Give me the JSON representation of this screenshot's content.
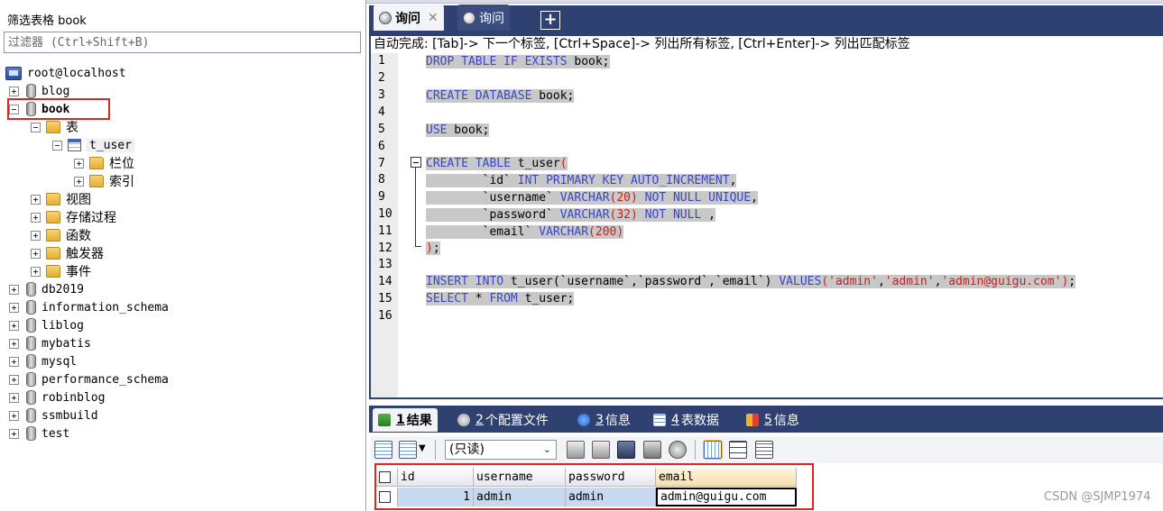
{
  "object_browser": {
    "filter_title": "筛选表格 book",
    "filter_placeholder": "过滤器 (Ctrl+Shift+B)",
    "connection": "root@localhost",
    "databases_before": [
      "blog"
    ],
    "selected_db": "book",
    "book_children": {
      "tables_folder": "表",
      "table_name": "t_user",
      "table_children": [
        "栏位",
        "索引"
      ],
      "other_folders": [
        "视图",
        "存储过程",
        "函数",
        "触发器",
        "事件"
      ]
    },
    "databases_after": [
      "db2019",
      "information_schema",
      "liblog",
      "mybatis",
      "mysql",
      "performance_schema",
      "robinblog",
      "ssmbuild",
      "test"
    ]
  },
  "query_tabs": [
    {
      "label": "询问",
      "active": true,
      "close": "✕"
    },
    {
      "label": "询问",
      "active": false
    }
  ],
  "add_tab_label": "+",
  "autocomplete_hint": "自动完成: [Tab]-> 下一个标签, [Ctrl+Space]-> 列出所有标签, [Ctrl+Enter]-> 列出匹配标签",
  "code_lines": [
    "1",
    "2",
    "3",
    "4",
    "5",
    "6",
    "7",
    "8",
    "9",
    "10",
    "11",
    "12",
    "13",
    "14",
    "15",
    "16"
  ],
  "code": {
    "l1": {
      "kw": "DROP TABLE IF EXISTS",
      "rest": " book;"
    },
    "l3": {
      "kw": "CREATE DATABASE",
      "rest": " book;"
    },
    "l5": {
      "kw": "USE",
      "rest": " book;"
    },
    "l7": {
      "kw": "CREATE TABLE",
      "rest": " t_user",
      "paren": "("
    },
    "l8": {
      "indent": "        ",
      "col": "`id`",
      "sp": " ",
      "kw": "INT PRIMARY KEY AUTO_INCREMENT",
      "end": ","
    },
    "l9": {
      "indent": "        ",
      "col": "`username`",
      "sp": " ",
      "kw": "VARCHAR",
      "args": "(20)",
      "sp2": " ",
      "kw2": "NOT NULL UNIQUE",
      "end": ","
    },
    "l10": {
      "indent": "        ",
      "col": "`password`",
      "sp": " ",
      "kw": "VARCHAR",
      "args": "(32)",
      "sp2": " ",
      "kw2": "NOT NULL",
      "end": " ,"
    },
    "l11": {
      "indent": "        ",
      "col": "`email`",
      "sp": " ",
      "kw": "VARCHAR",
      "args": "(200)"
    },
    "l12": {
      "paren": ")",
      "end": ";"
    },
    "l14": {
      "kw": "INSERT INTO",
      "rest": " t_user(`username`,`password`,`email`) ",
      "kw2": "VALUES",
      "p1": "(",
      "s1": "'admin'",
      "c1": ",",
      "s2": "'admin'",
      "c2": ",",
      "s3": "'admin@guigu.com'",
      "p2": ")",
      "end": ";"
    },
    "l15": {
      "kw": "SELECT",
      "rest": " * ",
      "kw2": "FROM",
      "rest2": " t_user;"
    }
  },
  "result_tabs": [
    {
      "num": "1",
      "label": "结果",
      "active": true
    },
    {
      "num": "2",
      "label": "个配置文件",
      "active": false
    },
    {
      "num": "3",
      "label": "信息",
      "active": false
    },
    {
      "num": "4",
      "label": "表数据",
      "active": false
    },
    {
      "num": "5",
      "label": "信息",
      "active": false
    }
  ],
  "readonly_select": "(只读)",
  "grid": {
    "columns": [
      "id",
      "username",
      "password",
      "email"
    ],
    "rows": [
      [
        "1",
        "admin",
        "admin",
        "admin@guigu.com"
      ]
    ]
  },
  "watermark": "CSDN @SJMP1974",
  "colors": {
    "keyword": "#3b47c8",
    "string": "#d61a1a",
    "highlight_box": "#e02424",
    "panel_blue": "#2e4170"
  }
}
